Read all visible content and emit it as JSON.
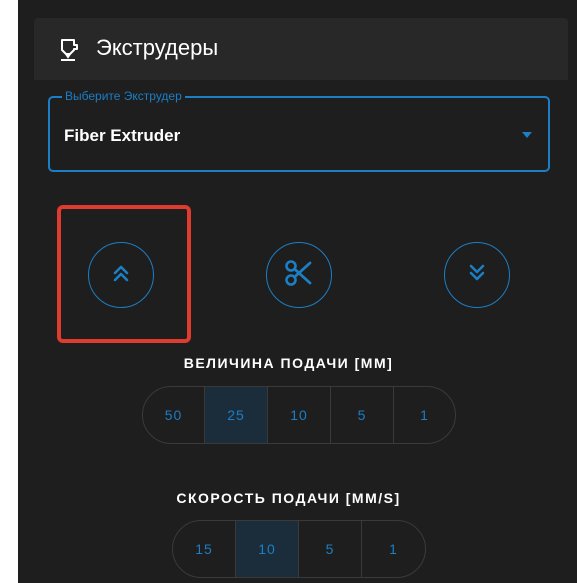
{
  "header": {
    "title": "Экструдеры",
    "icon": "extruder-icon"
  },
  "extruder_select": {
    "legend": "Выберите Экструдер",
    "value": "Fiber Extruder"
  },
  "actions": [
    {
      "name": "retract",
      "icon": "double-chevron-up-icon"
    },
    {
      "name": "cut",
      "icon": "scissors-icon"
    },
    {
      "name": "extrude",
      "icon": "double-chevron-down-icon"
    }
  ],
  "feed_amount": {
    "label": "ВЕЛИЧИНА ПОДАЧИ [MM]",
    "options": [
      "50",
      "25",
      "10",
      "5",
      "1"
    ],
    "selected": "25"
  },
  "feed_speed": {
    "label": "СКОРОСТЬ ПОДАЧИ [MM/S]",
    "options": [
      "15",
      "10",
      "5",
      "1"
    ],
    "selected": "10"
  },
  "colors": {
    "accent": "#1c7ec4",
    "highlight": "#e03b2f",
    "panel": "#1e1e1e"
  }
}
